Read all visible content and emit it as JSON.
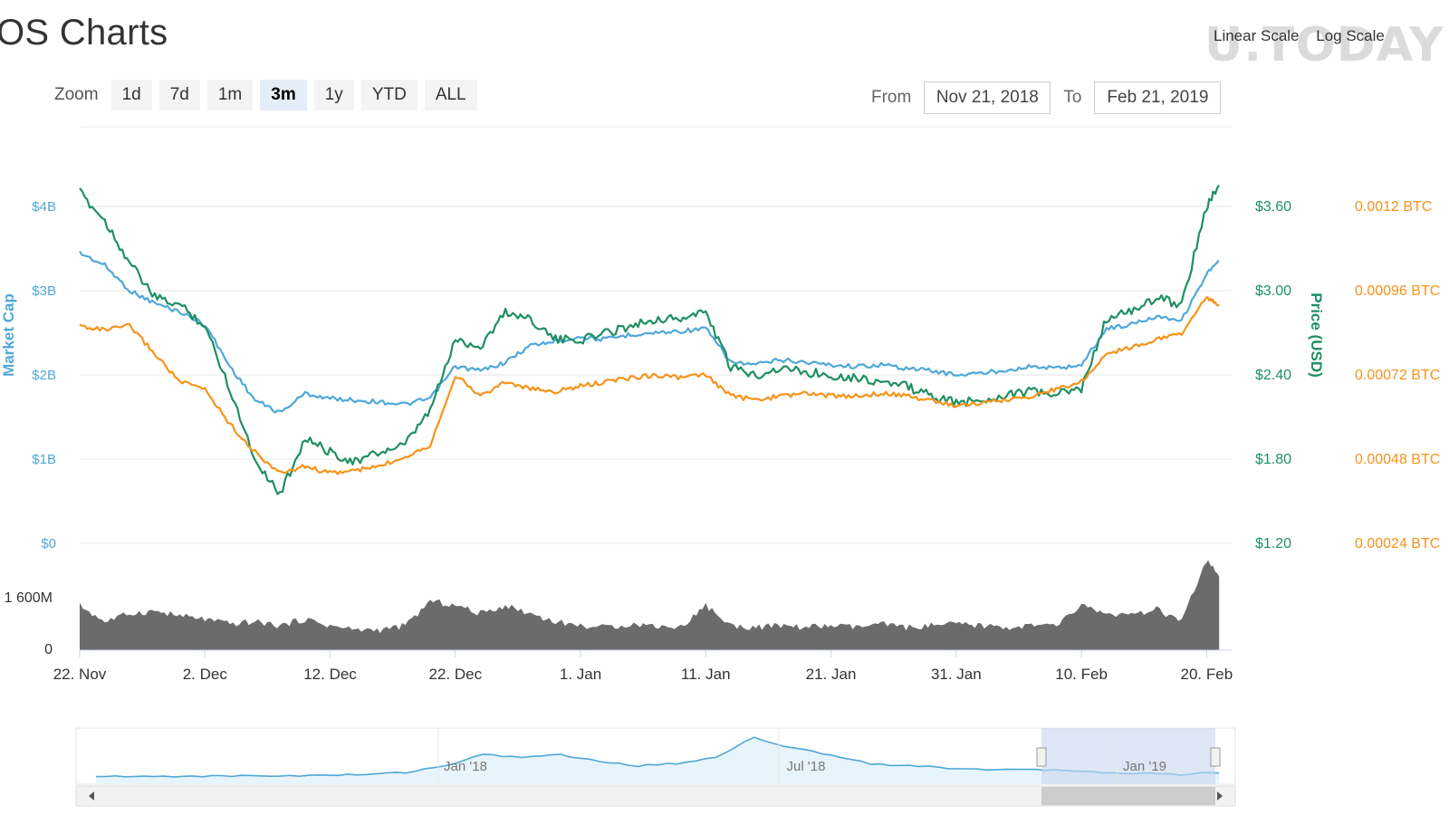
{
  "page": {
    "title": "OS Charts",
    "scale_options": [
      "Linear Scale",
      "Log Scale"
    ],
    "watermark": "U.TODAY"
  },
  "zoom": {
    "label": "Zoom",
    "buttons": [
      "1d",
      "7d",
      "1m",
      "3m",
      "1y",
      "YTD",
      "ALL"
    ],
    "active": "3m"
  },
  "range": {
    "from_label": "From",
    "from_value": "Nov 21, 2018",
    "to_label": "To",
    "to_value": "Feb 21, 2019"
  },
  "colors": {
    "market_cap": "#4fa8d9",
    "price_usd": "#1e8f63",
    "price_btc": "#f7931a",
    "volume": "#6b6b6b",
    "navigator_line": "#4fa8d9",
    "navigator_fill": "#e8f4fb",
    "navigator_mask": "#c8d6ee"
  },
  "chart_data": {
    "type": "line",
    "left_axis": {
      "title": "Market Cap",
      "ticks": [
        "$4B",
        "$3B",
        "$2B",
        "$1B",
        "$0"
      ],
      "range": [
        0,
        4
      ]
    },
    "right_axis": {
      "title": "Price (USD)",
      "ticks": [
        "$3.60",
        "$3.00",
        "$2.40",
        "$1.80",
        "$1.20"
      ],
      "range": [
        1.2,
        3.6
      ]
    },
    "btc_axis": {
      "ticks": [
        "0.0012 BTC",
        "0.00096 BTC",
        "0.00072 BTC",
        "0.00048 BTC",
        "0.00024 BTC"
      ]
    },
    "volume_axis": {
      "ticks": [
        "1 600M",
        "0"
      ]
    },
    "x_tick_labels": [
      "22. Nov",
      "2. Dec",
      "12. Dec",
      "22. Dec",
      "1. Jan",
      "11. Jan",
      "21. Jan",
      "31. Jan",
      "10. Feb",
      "20. Feb"
    ],
    "x_days": [
      0,
      10,
      20,
      30,
      40,
      50,
      60,
      70,
      80,
      90
    ],
    "series": [
      {
        "key": "market_cap",
        "axis": "left",
        "x": [
          0,
          2,
          4,
          6,
          8,
          10,
          12,
          14,
          16,
          18,
          20,
          22,
          24,
          26,
          28,
          30,
          32,
          34,
          36,
          38,
          40,
          42,
          44,
          46,
          48,
          50,
          52,
          54,
          56,
          58,
          60,
          62,
          64,
          66,
          68,
          70,
          72,
          74,
          76,
          78,
          80,
          82,
          84,
          86,
          88,
          90,
          91
        ],
        "y": [
          3.45,
          3.3,
          3.0,
          2.85,
          2.75,
          2.6,
          2.1,
          1.7,
          1.55,
          1.78,
          1.72,
          1.7,
          1.68,
          1.65,
          1.72,
          2.1,
          2.05,
          2.15,
          2.35,
          2.4,
          2.45,
          2.42,
          2.48,
          2.5,
          2.52,
          2.55,
          2.15,
          2.12,
          2.18,
          2.15,
          2.12,
          2.1,
          2.12,
          2.08,
          2.05,
          2.0,
          2.02,
          2.06,
          2.1,
          2.08,
          2.12,
          2.55,
          2.6,
          2.7,
          2.65,
          3.2,
          3.35
        ]
      },
      {
        "key": "price_usd",
        "axis": "right",
        "x": [
          0,
          2,
          4,
          6,
          8,
          10,
          12,
          14,
          16,
          18,
          20,
          22,
          24,
          26,
          28,
          30,
          32,
          34,
          36,
          38,
          40,
          42,
          44,
          46,
          48,
          50,
          52,
          54,
          56,
          58,
          60,
          62,
          64,
          66,
          68,
          70,
          72,
          74,
          76,
          78,
          80,
          82,
          84,
          86,
          88,
          90,
          91
        ],
        "y": [
          3.7,
          3.5,
          3.2,
          2.95,
          2.9,
          2.75,
          2.3,
          1.8,
          1.55,
          1.95,
          1.85,
          1.78,
          1.85,
          1.9,
          2.15,
          2.65,
          2.6,
          2.85,
          2.8,
          2.65,
          2.65,
          2.7,
          2.75,
          2.8,
          2.8,
          2.85,
          2.45,
          2.4,
          2.45,
          2.42,
          2.4,
          2.38,
          2.35,
          2.32,
          2.25,
          2.2,
          2.22,
          2.26,
          2.28,
          2.26,
          2.3,
          2.8,
          2.85,
          2.95,
          2.9,
          3.6,
          3.75
        ]
      },
      {
        "key": "price_btc",
        "axis": "right",
        "x": [
          0,
          2,
          4,
          6,
          8,
          10,
          12,
          14,
          16,
          18,
          20,
          22,
          24,
          26,
          28,
          30,
          32,
          34,
          36,
          38,
          40,
          42,
          44,
          46,
          48,
          50,
          52,
          54,
          56,
          58,
          60,
          62,
          64,
          66,
          68,
          70,
          72,
          74,
          76,
          78,
          80,
          82,
          84,
          86,
          88,
          90,
          91
        ],
        "y": [
          2.75,
          2.72,
          2.75,
          2.55,
          2.35,
          2.3,
          2.05,
          1.85,
          1.7,
          1.75,
          1.7,
          1.72,
          1.75,
          1.82,
          1.9,
          2.4,
          2.25,
          2.35,
          2.3,
          2.28,
          2.32,
          2.35,
          2.38,
          2.4,
          2.38,
          2.4,
          2.25,
          2.22,
          2.25,
          2.27,
          2.25,
          2.25,
          2.27,
          2.25,
          2.22,
          2.18,
          2.2,
          2.22,
          2.25,
          2.3,
          2.35,
          2.55,
          2.6,
          2.65,
          2.7,
          2.95,
          2.9
        ]
      }
    ],
    "volume": {
      "x": [
        0,
        2,
        4,
        6,
        8,
        10,
        12,
        14,
        16,
        18,
        20,
        22,
        24,
        26,
        28,
        30,
        32,
        34,
        36,
        38,
        40,
        42,
        44,
        46,
        48,
        50,
        52,
        54,
        56,
        58,
        60,
        62,
        64,
        66,
        68,
        70,
        72,
        74,
        76,
        78,
        80,
        82,
        84,
        86,
        88,
        90,
        91
      ],
      "y": [
        0.55,
        0.35,
        0.45,
        0.48,
        0.42,
        0.38,
        0.32,
        0.35,
        0.3,
        0.38,
        0.3,
        0.25,
        0.25,
        0.3,
        0.6,
        0.55,
        0.45,
        0.55,
        0.45,
        0.35,
        0.3,
        0.28,
        0.32,
        0.3,
        0.28,
        0.55,
        0.3,
        0.28,
        0.3,
        0.28,
        0.3,
        0.28,
        0.32,
        0.28,
        0.3,
        0.32,
        0.3,
        0.28,
        0.3,
        0.3,
        0.55,
        0.45,
        0.42,
        0.5,
        0.35,
        1.1,
        0.9
      ]
    },
    "navigator": {
      "labels": [
        "Jan '18",
        "Jul '18",
        "Jan '19"
      ],
      "y": [
        0.05,
        0.05,
        0.06,
        0.06,
        0.07,
        0.07,
        0.08,
        0.1,
        0.15,
        0.3,
        0.55,
        0.5,
        0.55,
        0.4,
        0.3,
        0.35,
        0.5,
        0.95,
        0.7,
        0.55,
        0.35,
        0.3,
        0.25,
        0.22,
        0.2,
        0.2,
        0.15,
        0.12,
        0.1,
        0.15
      ]
    },
    "grid": true
  }
}
